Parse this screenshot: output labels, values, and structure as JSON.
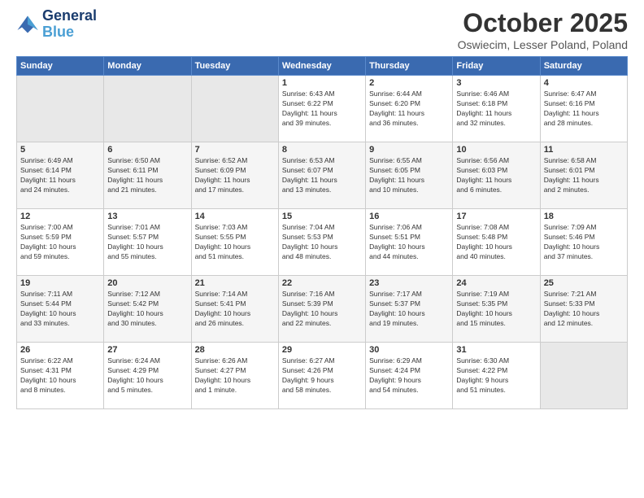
{
  "logo": {
    "line1": "General",
    "line2": "Blue"
  },
  "title": "October 2025",
  "location": "Oswiecim, Lesser Poland, Poland",
  "days_of_week": [
    "Sunday",
    "Monday",
    "Tuesday",
    "Wednesday",
    "Thursday",
    "Friday",
    "Saturday"
  ],
  "weeks": [
    [
      {
        "day": "",
        "info": ""
      },
      {
        "day": "",
        "info": ""
      },
      {
        "day": "",
        "info": ""
      },
      {
        "day": "1",
        "info": "Sunrise: 6:43 AM\nSunset: 6:22 PM\nDaylight: 11 hours\nand 39 minutes."
      },
      {
        "day": "2",
        "info": "Sunrise: 6:44 AM\nSunset: 6:20 PM\nDaylight: 11 hours\nand 36 minutes."
      },
      {
        "day": "3",
        "info": "Sunrise: 6:46 AM\nSunset: 6:18 PM\nDaylight: 11 hours\nand 32 minutes."
      },
      {
        "day": "4",
        "info": "Sunrise: 6:47 AM\nSunset: 6:16 PM\nDaylight: 11 hours\nand 28 minutes."
      }
    ],
    [
      {
        "day": "5",
        "info": "Sunrise: 6:49 AM\nSunset: 6:14 PM\nDaylight: 11 hours\nand 24 minutes."
      },
      {
        "day": "6",
        "info": "Sunrise: 6:50 AM\nSunset: 6:11 PM\nDaylight: 11 hours\nand 21 minutes."
      },
      {
        "day": "7",
        "info": "Sunrise: 6:52 AM\nSunset: 6:09 PM\nDaylight: 11 hours\nand 17 minutes."
      },
      {
        "day": "8",
        "info": "Sunrise: 6:53 AM\nSunset: 6:07 PM\nDaylight: 11 hours\nand 13 minutes."
      },
      {
        "day": "9",
        "info": "Sunrise: 6:55 AM\nSunset: 6:05 PM\nDaylight: 11 hours\nand 10 minutes."
      },
      {
        "day": "10",
        "info": "Sunrise: 6:56 AM\nSunset: 6:03 PM\nDaylight: 11 hours\nand 6 minutes."
      },
      {
        "day": "11",
        "info": "Sunrise: 6:58 AM\nSunset: 6:01 PM\nDaylight: 11 hours\nand 2 minutes."
      }
    ],
    [
      {
        "day": "12",
        "info": "Sunrise: 7:00 AM\nSunset: 5:59 PM\nDaylight: 10 hours\nand 59 minutes."
      },
      {
        "day": "13",
        "info": "Sunrise: 7:01 AM\nSunset: 5:57 PM\nDaylight: 10 hours\nand 55 minutes."
      },
      {
        "day": "14",
        "info": "Sunrise: 7:03 AM\nSunset: 5:55 PM\nDaylight: 10 hours\nand 51 minutes."
      },
      {
        "day": "15",
        "info": "Sunrise: 7:04 AM\nSunset: 5:53 PM\nDaylight: 10 hours\nand 48 minutes."
      },
      {
        "day": "16",
        "info": "Sunrise: 7:06 AM\nSunset: 5:51 PM\nDaylight: 10 hours\nand 44 minutes."
      },
      {
        "day": "17",
        "info": "Sunrise: 7:08 AM\nSunset: 5:48 PM\nDaylight: 10 hours\nand 40 minutes."
      },
      {
        "day": "18",
        "info": "Sunrise: 7:09 AM\nSunset: 5:46 PM\nDaylight: 10 hours\nand 37 minutes."
      }
    ],
    [
      {
        "day": "19",
        "info": "Sunrise: 7:11 AM\nSunset: 5:44 PM\nDaylight: 10 hours\nand 33 minutes."
      },
      {
        "day": "20",
        "info": "Sunrise: 7:12 AM\nSunset: 5:42 PM\nDaylight: 10 hours\nand 30 minutes."
      },
      {
        "day": "21",
        "info": "Sunrise: 7:14 AM\nSunset: 5:41 PM\nDaylight: 10 hours\nand 26 minutes."
      },
      {
        "day": "22",
        "info": "Sunrise: 7:16 AM\nSunset: 5:39 PM\nDaylight: 10 hours\nand 22 minutes."
      },
      {
        "day": "23",
        "info": "Sunrise: 7:17 AM\nSunset: 5:37 PM\nDaylight: 10 hours\nand 19 minutes."
      },
      {
        "day": "24",
        "info": "Sunrise: 7:19 AM\nSunset: 5:35 PM\nDaylight: 10 hours\nand 15 minutes."
      },
      {
        "day": "25",
        "info": "Sunrise: 7:21 AM\nSunset: 5:33 PM\nDaylight: 10 hours\nand 12 minutes."
      }
    ],
    [
      {
        "day": "26",
        "info": "Sunrise: 6:22 AM\nSunset: 4:31 PM\nDaylight: 10 hours\nand 8 minutes."
      },
      {
        "day": "27",
        "info": "Sunrise: 6:24 AM\nSunset: 4:29 PM\nDaylight: 10 hours\nand 5 minutes."
      },
      {
        "day": "28",
        "info": "Sunrise: 6:26 AM\nSunset: 4:27 PM\nDaylight: 10 hours\nand 1 minute."
      },
      {
        "day": "29",
        "info": "Sunrise: 6:27 AM\nSunset: 4:26 PM\nDaylight: 9 hours\nand 58 minutes."
      },
      {
        "day": "30",
        "info": "Sunrise: 6:29 AM\nSunset: 4:24 PM\nDaylight: 9 hours\nand 54 minutes."
      },
      {
        "day": "31",
        "info": "Sunrise: 6:30 AM\nSunset: 4:22 PM\nDaylight: 9 hours\nand 51 minutes."
      },
      {
        "day": "",
        "info": ""
      }
    ]
  ]
}
